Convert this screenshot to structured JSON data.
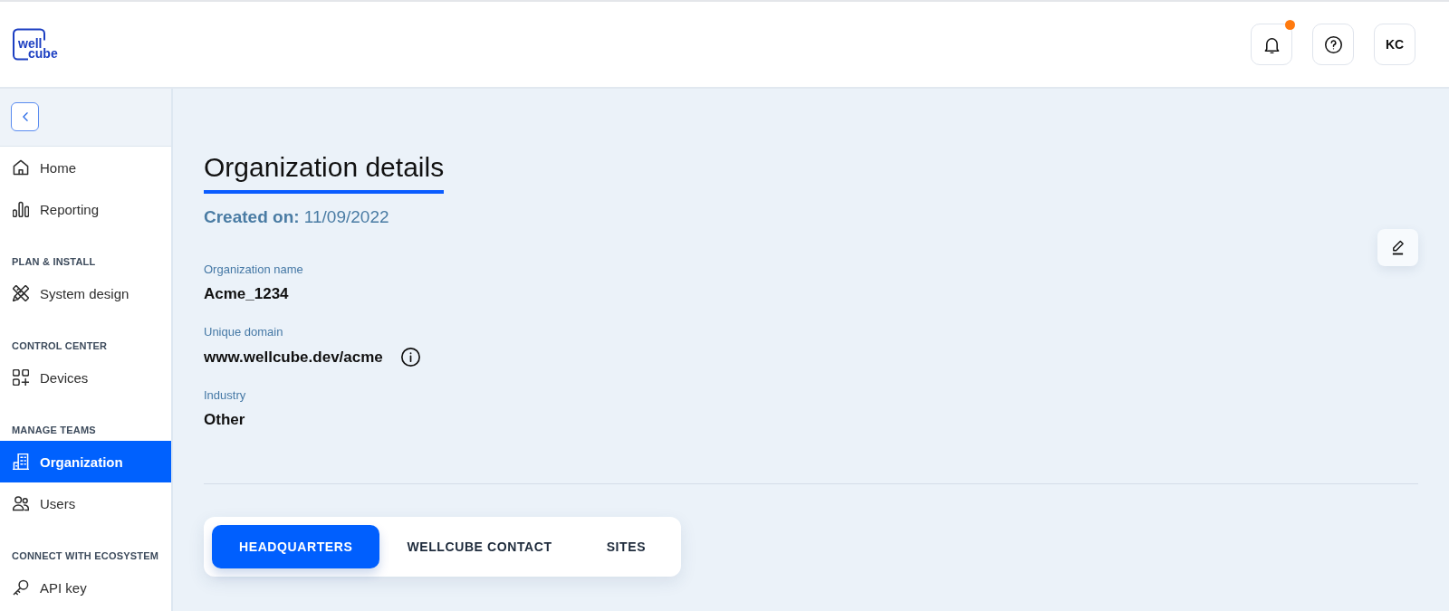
{
  "header": {
    "logo_lines": [
      "well",
      "cube"
    ],
    "actions": [
      {
        "kind": "notifications",
        "unread": true
      },
      {
        "kind": "help"
      },
      {
        "kind": "account",
        "initials": "KC"
      }
    ]
  },
  "sidebar": {
    "sections": [
      {
        "items": [
          {
            "label": "Home",
            "selected": false
          },
          {
            "label": "Reporting",
            "selected": false
          }
        ]
      },
      {
        "heading": "PLAN & INSTALL",
        "items": [
          {
            "label": "System design",
            "selected": false
          }
        ]
      },
      {
        "heading": "CONTROL CENTER",
        "items": [
          {
            "label": "Devices",
            "selected": false
          }
        ]
      },
      {
        "heading": "MANAGE TEAMS",
        "items": [
          {
            "label": "Organization",
            "selected": true
          },
          {
            "label": "Users",
            "selected": false
          }
        ]
      },
      {
        "heading": "CONNECT WITH ECOSYSTEM",
        "items": [
          {
            "label": "API key",
            "selected": false
          }
        ]
      }
    ]
  },
  "page": {
    "title": "Organization details",
    "created": "**Created on:** 11/09/2022",
    "fields": [
      {
        "label": "Organization name",
        "value": "Acme_1234",
        "info": false
      },
      {
        "label": "Unique domain",
        "value": "www.wellcube.dev/acme",
        "info": true
      },
      {
        "label": "Industry",
        "value": "Other",
        "info": false
      }
    ],
    "tabs": [
      {
        "label": "HEADQUARTERS",
        "selected": true
      },
      {
        "label": "WELLCUBE CONTACT",
        "selected": false
      },
      {
        "label": "SITES",
        "selected": false
      }
    ]
  }
}
